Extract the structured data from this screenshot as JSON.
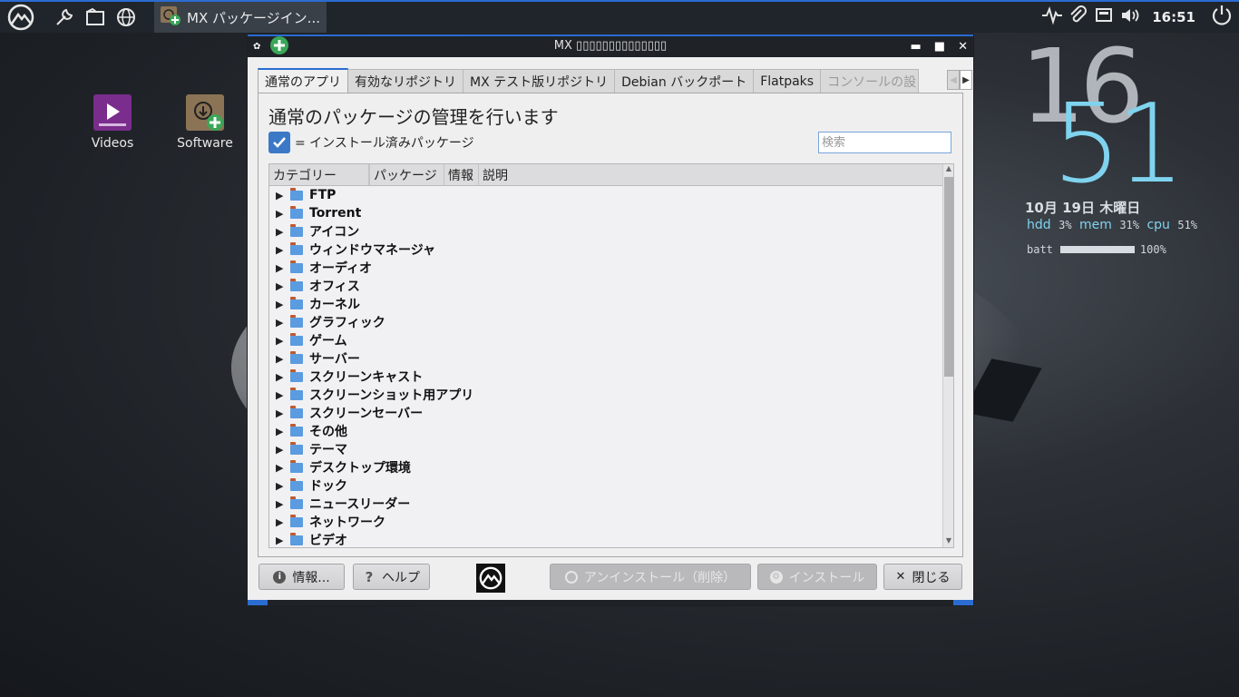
{
  "panel": {
    "task_title": "MX パッケージイン...",
    "clock": "16:51"
  },
  "desktop": {
    "icons": [
      {
        "label": "Videos"
      },
      {
        "label": "Software"
      }
    ]
  },
  "conky": {
    "hours": "16",
    "minutes": "51",
    "date": "10月 19日 木曜日",
    "hdd_label": "hdd",
    "hdd_value": "3%",
    "mem_label": "mem",
    "mem_value": "31%",
    "cpu_label": "cpu",
    "cpu_value": "51%",
    "batt_label": "batt",
    "batt_value": "100%",
    "batt_level": 1.0
  },
  "window": {
    "title": "MX ▯▯▯▯▯▯▯▯▯▯▯▯▯▯",
    "tabs": [
      {
        "label": "通常のアプリ",
        "active": true
      },
      {
        "label": "有効なリポジトリ"
      },
      {
        "label": "MX テスト版リポジトリ"
      },
      {
        "label": "Debian バックポート"
      },
      {
        "label": "Flatpaks"
      },
      {
        "label": "コンソールの設"
      }
    ],
    "heading": "通常のパッケージの管理を行います",
    "legend_text": "= インストール済みパッケージ",
    "search_placeholder": "検索",
    "columns": [
      "カテゴリー",
      "",
      "パッケージ",
      "情報",
      "説明"
    ],
    "categories": [
      "FTP",
      "Torrent",
      "アイコン",
      "ウィンドウマネージャ",
      "オーディオ",
      "オフィス",
      "カーネル",
      "グラフィック",
      "ゲーム",
      "サーバー",
      "スクリーンキャスト",
      "スクリーンショット用アプリ",
      "スクリーンセーバー",
      "その他",
      "テーマ",
      "デスクトップ環境",
      "ドック",
      "ニュースリーダー",
      "ネットワーク",
      "ビデオ"
    ],
    "buttons": {
      "info": "情報...",
      "help": "ヘルプ",
      "uninstall": "アンインストール（削除）",
      "install": "インストール",
      "close": "閉じる"
    }
  }
}
